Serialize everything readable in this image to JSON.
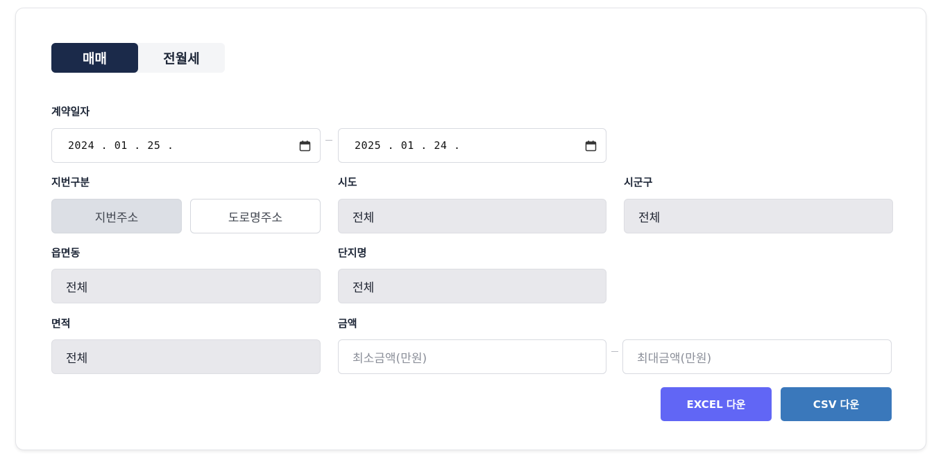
{
  "tabs": [
    {
      "label": "매매",
      "active": true
    },
    {
      "label": "전월세",
      "active": false
    }
  ],
  "contract_date": {
    "label": "계약일자",
    "start": "2024 .  01 .  25 .",
    "end": "2025 .  01 .  24 ."
  },
  "lot_type": {
    "label": "지번구분",
    "options": [
      "지번주소",
      "도로명주소"
    ],
    "selected": "지번주소"
  },
  "sido": {
    "label": "시도",
    "value": "전체"
  },
  "sigungu": {
    "label": "시군구",
    "value": "전체"
  },
  "eupmyeondong": {
    "label": "읍면동",
    "value": "전체"
  },
  "complex_name": {
    "label": "단지명",
    "value": "전체"
  },
  "area": {
    "label": "면적",
    "value": "전체"
  },
  "amount": {
    "label": "금액",
    "min_placeholder": "최소금액(만원)",
    "max_placeholder": "최대금액(만원)"
  },
  "buttons": {
    "excel": "EXCEL 다운",
    "csv": "CSV 다운"
  },
  "colors": {
    "tab_active": "#1b2a4a",
    "excel_button": "#6166f5",
    "csv_button": "#3a78bb"
  }
}
